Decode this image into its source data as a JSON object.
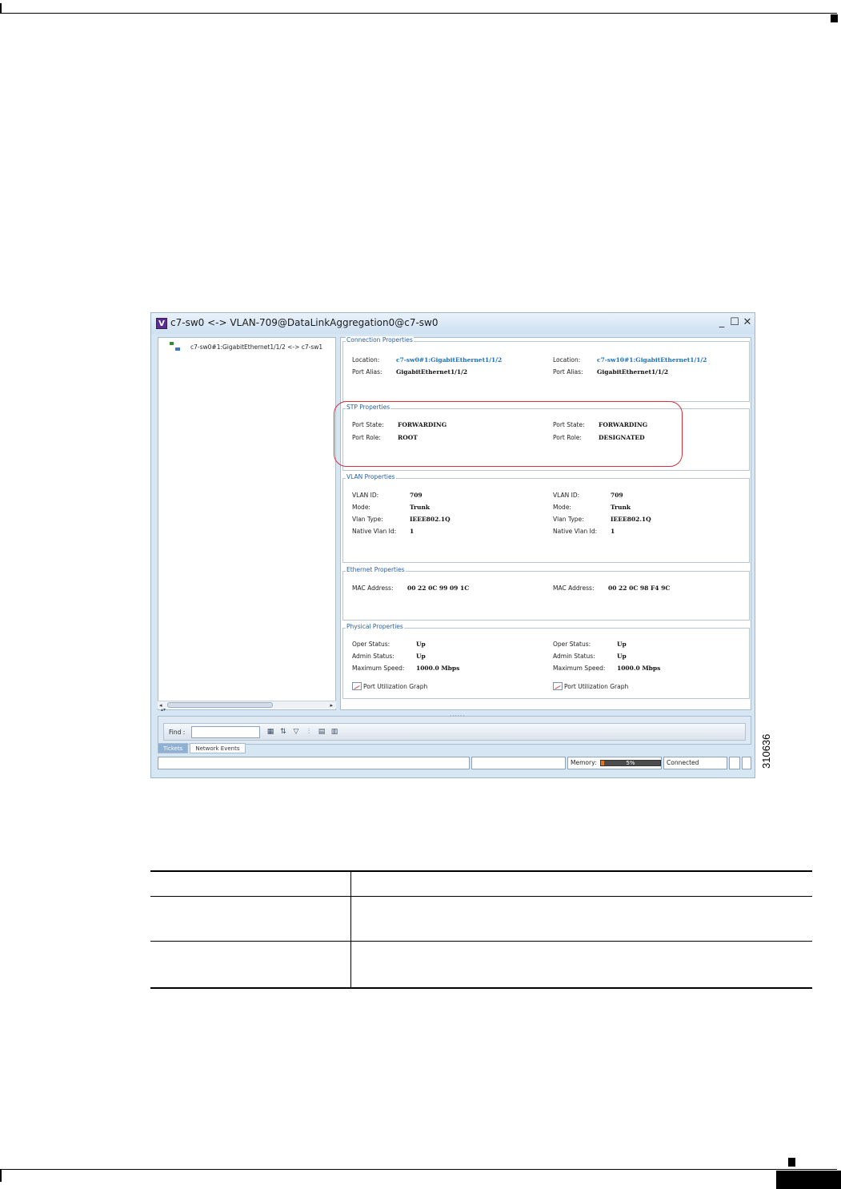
{
  "window": {
    "app_icon_letter": "V",
    "title": "c7-sw0 <-> VLAN-709@DataLinkAggregation0@c7-sw0",
    "minimize_glyph": "_",
    "maximize_glyph": "☐",
    "close_glyph": "✕"
  },
  "tree": {
    "item_label": "c7-sw0#1:GigabitEthernet1/1/2 <-> c7-sw1"
  },
  "connection_properties": {
    "title": "Connection Properties",
    "left": {
      "location_label": "Location:",
      "location_value": "c7-sw0#1:GigabitEthernet1/1/2",
      "alias_label": "Port Alias:",
      "alias_value": "GigabitEthernet1/1/2"
    },
    "right": {
      "location_label": "Location:",
      "location_value": "c7-sw10#1:GigabitEthernet1/1/2",
      "alias_label": "Port Alias:",
      "alias_value": "GigabitEthernet1/1/2"
    }
  },
  "stp_properties": {
    "title": "STP Properties",
    "left": {
      "state_label": "Port State:",
      "state_value": "FORWARDING",
      "role_label": "Port Role:",
      "role_value": "ROOT"
    },
    "right": {
      "state_label": "Port State:",
      "state_value": "FORWARDING",
      "role_label": "Port Role:",
      "role_value": "DESIGNATED"
    }
  },
  "vlan_properties": {
    "title": "VLAN Properties",
    "left": {
      "id_label": "VLAN ID:",
      "id_value": "709",
      "mode_label": "Mode:",
      "mode_value": "Trunk",
      "type_label": "Vlan Type:",
      "type_value": "IEEE802.1Q",
      "native_label": "Native Vlan Id:",
      "native_value": "1"
    },
    "right": {
      "id_label": "VLAN ID:",
      "id_value": "709",
      "mode_label": "Mode:",
      "mode_value": "Trunk",
      "type_label": "Vlan Type:",
      "type_value": "IEEE802.1Q",
      "native_label": "Native Vlan Id:",
      "native_value": "1"
    }
  },
  "ethernet_properties": {
    "title": "Ethernet Properties",
    "left": {
      "mac_label": "MAC Address:",
      "mac_value": "00 22 0C 99 09 1C"
    },
    "right": {
      "mac_label": "MAC Address:",
      "mac_value": "00 22 0C 98 F4 9C"
    }
  },
  "physical_properties": {
    "title": "Physical Properties",
    "left": {
      "oper_label": "Oper Status:",
      "oper_value": "Up",
      "admin_label": "Admin Status:",
      "admin_value": "Up",
      "speed_label": "Maximum Speed:",
      "speed_value": "1000.0 Mbps",
      "graph_label": "Port Utilization Graph"
    },
    "right": {
      "oper_label": "Oper Status:",
      "oper_value": "Up",
      "admin_label": "Admin Status:",
      "admin_value": "Up",
      "speed_label": "Maximum Speed:",
      "speed_value": "1000.0 Mbps",
      "graph_label": "Port Utilization Graph"
    }
  },
  "find_bar": {
    "label": "Find :",
    "input_value": "",
    "tool_icons": [
      "table-icon",
      "sort-icon",
      "filter-icon",
      "columns-icon",
      "export-icon",
      "print-icon"
    ]
  },
  "tabs": [
    "Tickets",
    "Network Events"
  ],
  "status_bar": {
    "memory_label": "Memory:",
    "memory_percent_text": "5%",
    "memory_fraction": 0.05,
    "connection_status": "Connected",
    "colors": {
      "memory_fill": "#e8731f"
    }
  },
  "figure_id": "310636",
  "highlight_color": "#d0313a"
}
